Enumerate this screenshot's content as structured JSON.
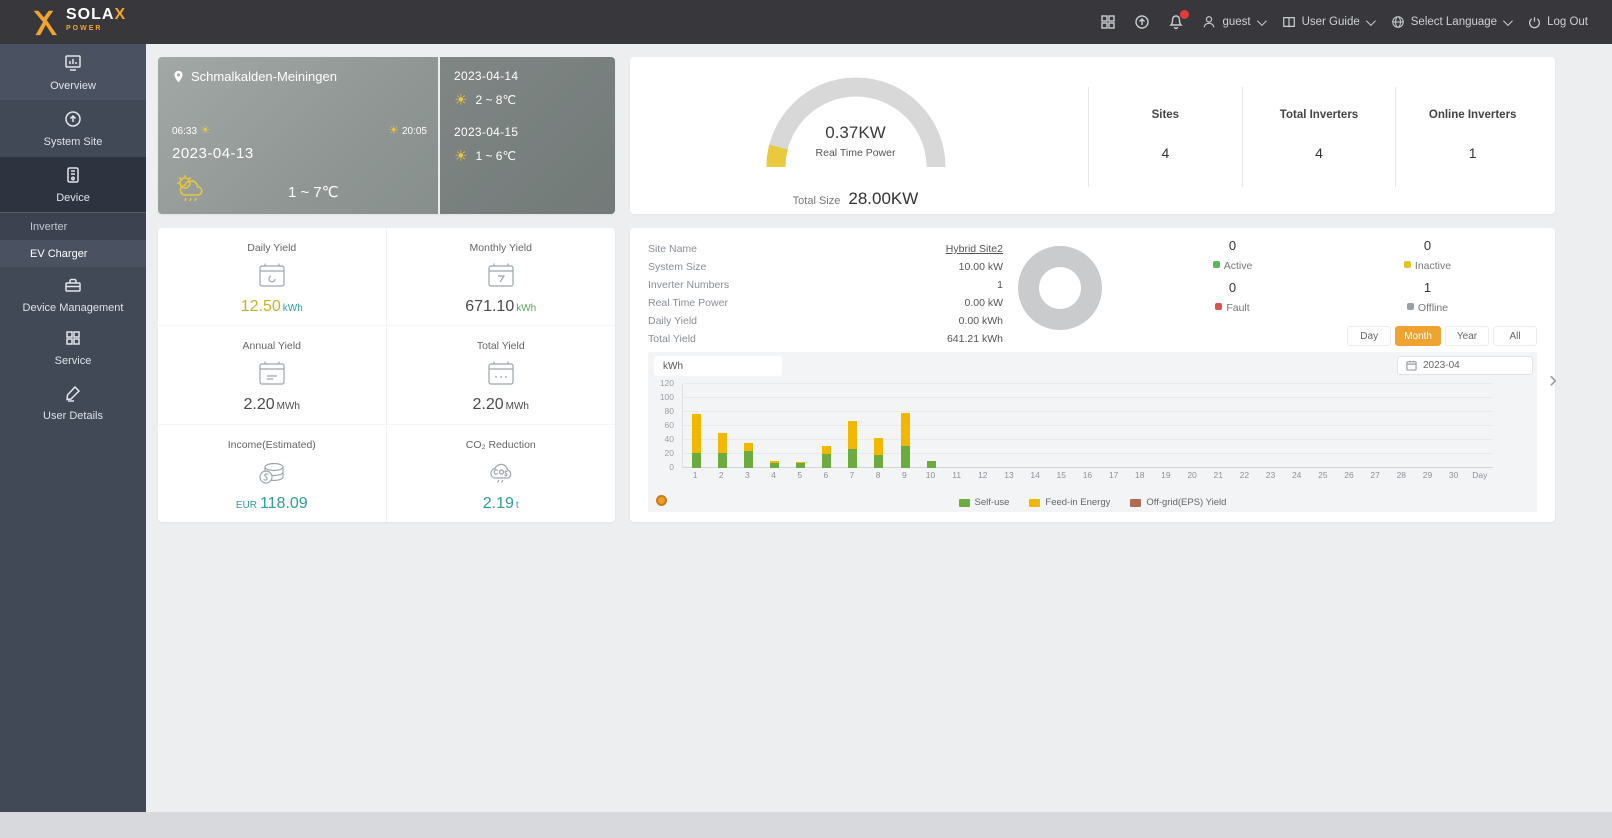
{
  "navbar": {
    "brand": "SOLA",
    "brand_x": "X",
    "brand_sub": "POWER",
    "user": "guest",
    "user_guide": "User Guide",
    "select_language": "Select Language",
    "logout": "Log Out"
  },
  "icons": {
    "logo": "x-mark",
    "apps": "grid",
    "upload": "circle-arrow",
    "notifications": "bell-with-red-badge",
    "user": "person",
    "guide": "book",
    "language": "globe",
    "logout": "power",
    "location": "map-pin",
    "sun": "☀",
    "weather": "sun-cloud-rain",
    "calendar": "calendar",
    "income": "coins",
    "co2": "co2-cloud",
    "next": "›"
  },
  "sidebar": {
    "items": [
      {
        "label": "Overview"
      },
      {
        "label": "System Site"
      },
      {
        "label": "Device"
      },
      {
        "label": "Inverter"
      },
      {
        "label": "EV Charger"
      },
      {
        "label": "Device Management"
      },
      {
        "label": "Service"
      },
      {
        "label": "User Details"
      }
    ]
  },
  "weather": {
    "location": "Schmalkalden-Meiningen",
    "sunrise": "06:33",
    "sunset": "20:05",
    "today": {
      "date": "2023-04-13",
      "temp": "1 ~ 7℃"
    },
    "forecast": [
      {
        "date": "2023-04-14",
        "temp": "2 ~ 8℃"
      },
      {
        "date": "2023-04-15",
        "temp": "1 ~ 6℃"
      }
    ]
  },
  "gauge": {
    "value": "0.37KW",
    "label": "Real Time Power",
    "total_label": "Total Size",
    "total_value": "28.00KW"
  },
  "stats": [
    {
      "label": "Sites",
      "value": "4"
    },
    {
      "label": "Total Inverters",
      "value": "4"
    },
    {
      "label": "Online Inverters",
      "value": "1"
    }
  ],
  "yields": [
    {
      "label": "Daily Yield",
      "value": "12.50",
      "unit": "kWh"
    },
    {
      "label": "Monthly Yield",
      "value": "671.10",
      "unit": "kWh"
    },
    {
      "label": "Annual Yield",
      "value": "2.20",
      "unit": "MWh"
    },
    {
      "label": "Total Yield",
      "value": "2.20",
      "unit": "MWh"
    },
    {
      "label": "Income(Estimated)",
      "prefix": "EUR",
      "value": "118.09",
      "unit": ""
    },
    {
      "label": "CO₂ Reduction",
      "value": "2.19",
      "unit": "t"
    }
  ],
  "site": {
    "info": [
      {
        "label": "Site Name",
        "value": "Hybrid Site2"
      },
      {
        "label": "System Size",
        "value": "10.00 kW"
      },
      {
        "label": "Inverter Numbers",
        "value": "1"
      },
      {
        "label": "Real Time Power",
        "value": "0.00 kW"
      },
      {
        "label": "Daily Yield",
        "value": "0.00 kWh"
      },
      {
        "label": "Total Yield",
        "value": "641.21 kWh"
      }
    ],
    "status": [
      {
        "count": "0",
        "label": "Active"
      },
      {
        "count": "0",
        "label": "Inactive"
      },
      {
        "count": "0",
        "label": "Fault"
      },
      {
        "count": "1",
        "label": "Offline"
      }
    ],
    "range_buttons": [
      "Day",
      "Month",
      "Year",
      "All"
    ],
    "selected_range": "Month",
    "date_value": "2023-04",
    "next_arrow": "›"
  },
  "colors": {
    "accent_orange": "#f0a232",
    "gauge_gray": "#d8d8d8",
    "gauge_yellow": "#e9c93d",
    "status_active": "#5cb85c",
    "status_inactive": "#e3c823",
    "status_fault": "#d9534f",
    "status_offline": "#9aa0a6"
  },
  "chart_data": {
    "type": "bar",
    "stacked": true,
    "unit_tab": "kWh",
    "x": [
      1,
      2,
      3,
      4,
      5,
      6,
      7,
      8,
      9,
      10,
      11,
      12,
      13,
      14,
      15,
      16,
      17,
      18,
      19,
      20,
      21,
      22,
      23,
      24,
      25,
      26,
      27,
      28,
      29,
      30
    ],
    "xlabel_suffix": "Day",
    "ylim": [
      0,
      120
    ],
    "yticks": [
      0,
      20,
      40,
      60,
      80,
      100,
      120
    ],
    "grid": true,
    "legend_position": "bottom",
    "series": [
      {
        "name": "Self-use",
        "color": "#6cab3f",
        "values": [
          22,
          21,
          25,
          7,
          7,
          20,
          27,
          19,
          32,
          10,
          0,
          0,
          0,
          0,
          0,
          0,
          0,
          0,
          0,
          0,
          0,
          0,
          0,
          0,
          0,
          0,
          0,
          0,
          0,
          0
        ]
      },
      {
        "name": "Feed-in Energy",
        "color": "#f2b800",
        "values": [
          55,
          29,
          11,
          3,
          2,
          12,
          40,
          24,
          46,
          0,
          0,
          0,
          0,
          0,
          0,
          0,
          0,
          0,
          0,
          0,
          0,
          0,
          0,
          0,
          0,
          0,
          0,
          0,
          0,
          0
        ]
      },
      {
        "name": "Off-grid(EPS) Yield",
        "color": "#b06b52",
        "values": [
          0,
          0,
          0,
          0,
          0,
          0,
          0,
          0,
          0,
          0,
          0,
          0,
          0,
          0,
          0,
          0,
          0,
          0,
          0,
          0,
          0,
          0,
          0,
          0,
          0,
          0,
          0,
          0,
          0,
          0
        ]
      }
    ]
  }
}
